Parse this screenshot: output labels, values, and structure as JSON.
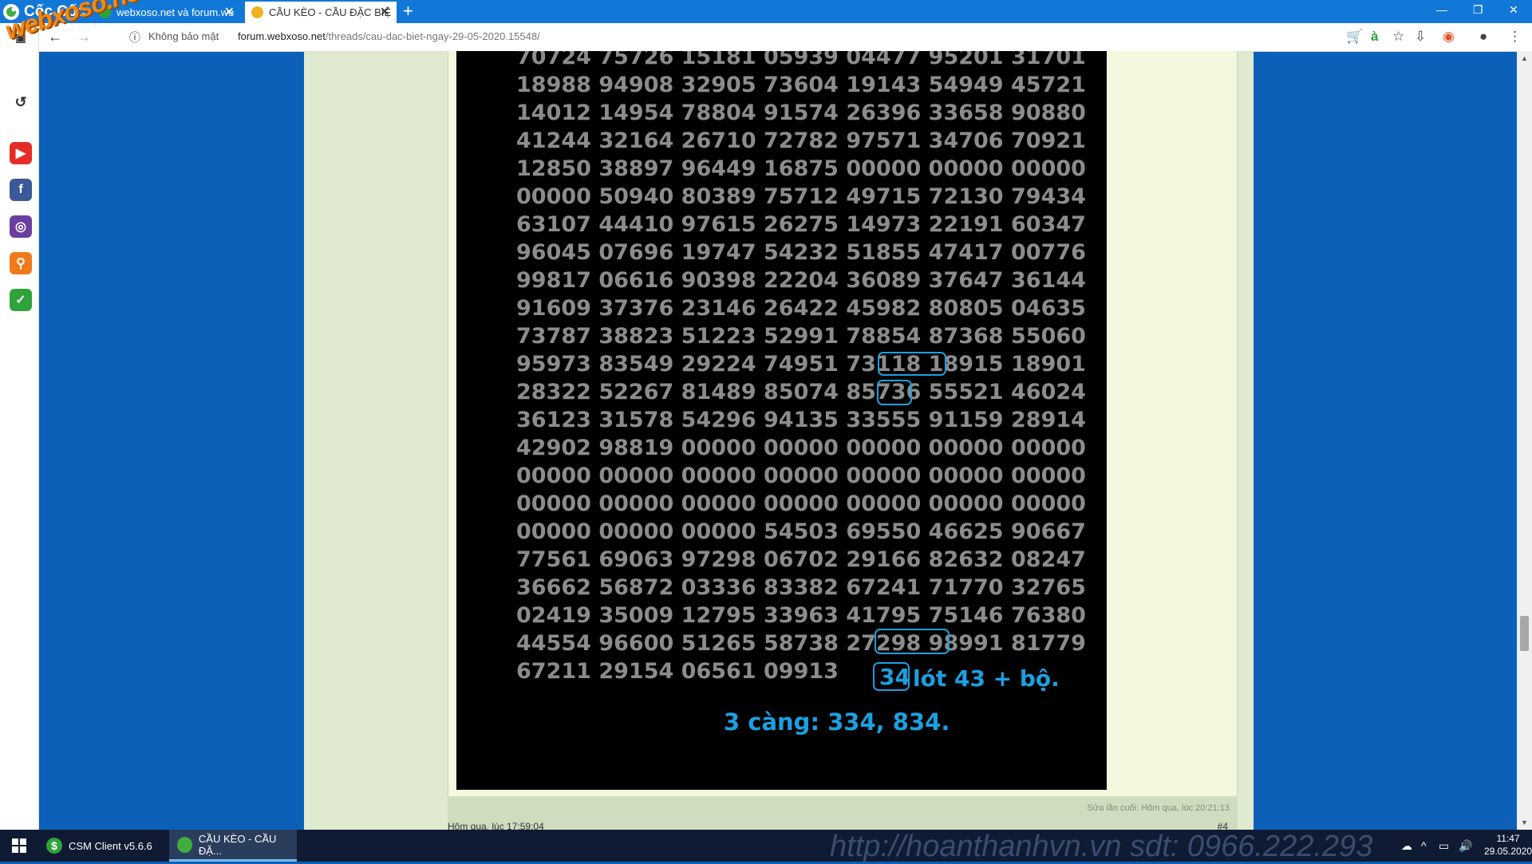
{
  "browser": {
    "brand": "Cốc Cốc",
    "tabs": [
      {
        "title": "webxoso.net và forum.we"
      },
      {
        "title": "CẦU KÈO - CẦU ĐẶC BIỆ"
      }
    ],
    "new_tab": "+",
    "security_label": "Không bảo mật",
    "url_host": "forum.webxoso.net",
    "url_path": "/threads/cau-dac-biet-ngay-29-05-2020.15548/",
    "watermark": "webxoso.net"
  },
  "post": {
    "image_rows": [
      "70724 75726 15181 05939 04477 95201 31701",
      "18988 94908 32905 73604 19143 54949 45721",
      "14012 14954 78804 91574 26396 33658 90880",
      "41244 32164 26710 72782 97571 34706 70921",
      "12850 38897 96449 16875 00000 00000 00000",
      "00000 50940 80389 75712 49715 72130 79434",
      "63107 44410 97615 26275 14973 22191 60347",
      "96045 07696 19747 54232 51855 47417 00776",
      "99817 06616 90398 22204 36089 37647 36144",
      "91609 37376 23146 26422 45982 80805 04635",
      "73787 38823 51223 52991 78854 87368 55060",
      "95973 83549 29224 74951 73118 18915 18901",
      "28322 52267 81489 85074 85736 55521 46024",
      "36123 31578 54296 94135 33555 91159 28914",
      "42902 98819 00000 00000 00000 00000 00000",
      "00000 00000 00000 00000 00000 00000 00000",
      "00000 00000 00000 00000 00000 00000 00000",
      "00000 00000 00000 54503 69550 46625 90667",
      "77561 69063 97298 06702 29166 82632 08247",
      "36662 56872 03336 83382 67241 71770 32765",
      "02419 35009 12795 33963 41795 75146 76380",
      "44554 96600 51265 58738 27298 98991 81779",
      "67211 29154 06561 09913"
    ],
    "highlight_pair_top": "18 18",
    "highlight_result_top": "36",
    "highlight_pair_bottom": "98  98",
    "highlight_result_bottom": "34",
    "prediction_text": "lót 43 + bộ.",
    "three_digit_text": "3 càng: 334, 834.",
    "edit_note": "Sửa lần cuối: Hôm qua, lúc 20:21:13",
    "post_time": "Hôm qua, lúc 17:59:04",
    "post_number": "#4"
  },
  "taskbar": {
    "apps": [
      {
        "label": "CSM Client v5.6.6"
      },
      {
        "label": "CẦU KÈO - CẦU ĐẶ..."
      }
    ],
    "background_text": "http://hoanthanhvn.vn   sdt: 0966.222.293",
    "time": "11:47",
    "date": "29.05.2020"
  },
  "colors": {
    "tabbar": "#1278d8",
    "page_bg": "#0d60b8",
    "annotation": "#1ba0e0",
    "digits": "#8c8c8c"
  }
}
